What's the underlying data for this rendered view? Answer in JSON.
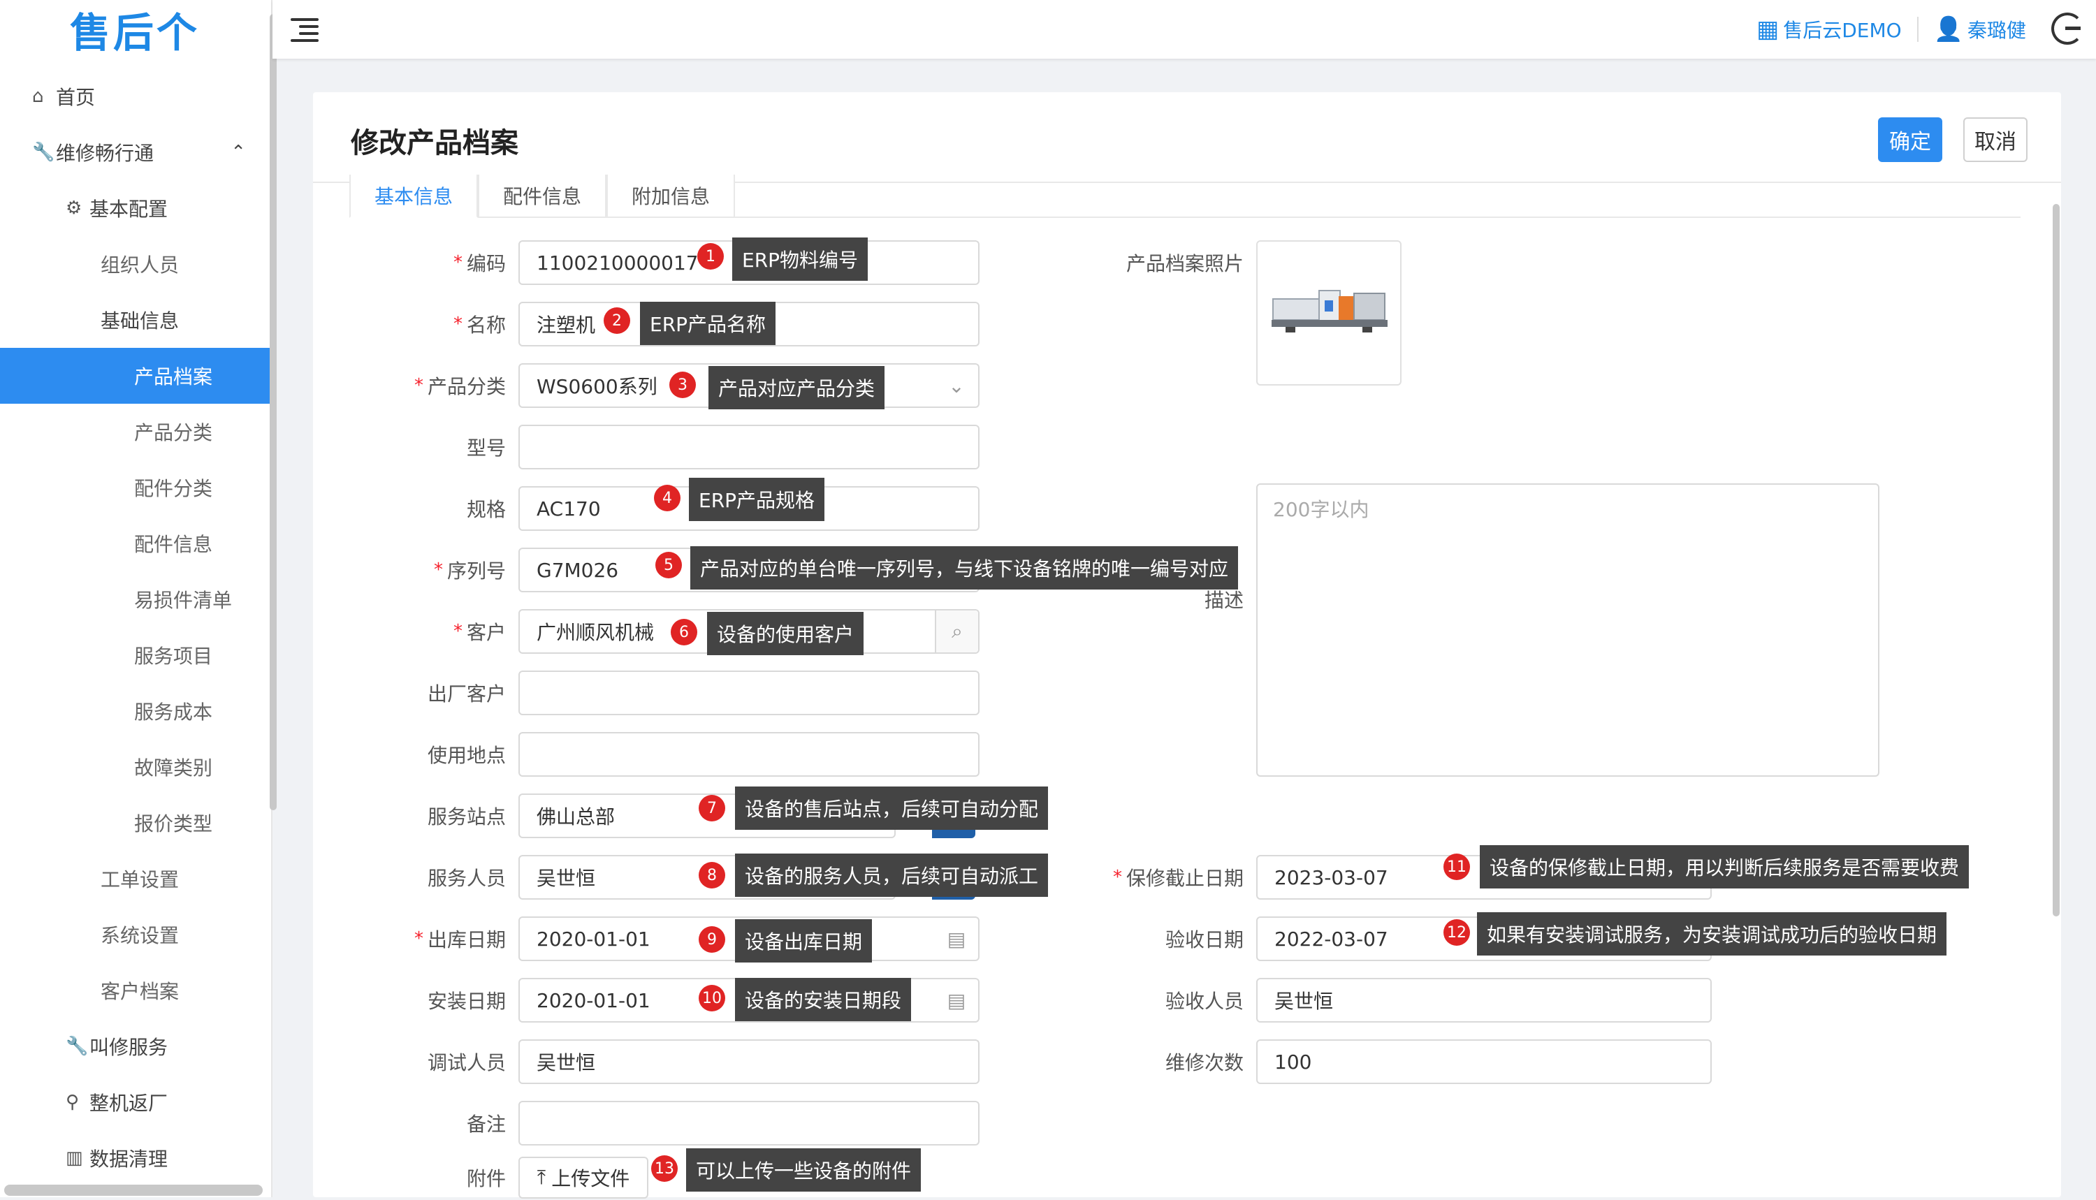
{
  "app": {
    "logo_text": "售后个",
    "org_name": "售后云DEMO",
    "user_name": "秦璐健"
  },
  "sidebar": {
    "items": [
      {
        "label": "首页",
        "icon": "home-icon"
      },
      {
        "label": "维修畅行通",
        "icon": "wrench-icon"
      },
      {
        "label": "基本配置",
        "icon": "gear-icon"
      },
      {
        "label": "组织人员"
      },
      {
        "label": "基础信息"
      },
      {
        "label": "产品档案"
      },
      {
        "label": "产品分类"
      },
      {
        "label": "配件分类"
      },
      {
        "label": "配件信息"
      },
      {
        "label": "易损件清单"
      },
      {
        "label": "服务项目"
      },
      {
        "label": "服务成本"
      },
      {
        "label": "故障类别"
      },
      {
        "label": "报价类型"
      },
      {
        "label": "工单设置"
      },
      {
        "label": "系统设置"
      },
      {
        "label": "客户档案"
      },
      {
        "label": "叫修服务",
        "icon": "wrench-icon"
      },
      {
        "label": "整机返厂",
        "icon": "link-icon"
      },
      {
        "label": "数据清理",
        "icon": "building-icon"
      }
    ]
  },
  "page": {
    "title": "修改产品档案",
    "confirm_label": "确定",
    "cancel_label": "取消",
    "tabs": [
      {
        "label": "基本信息"
      },
      {
        "label": "配件信息"
      },
      {
        "label": "附加信息"
      }
    ]
  },
  "form": {
    "code": {
      "label": "编码",
      "value": "1100210000017"
    },
    "name": {
      "label": "名称",
      "value": "注塑机"
    },
    "category": {
      "label": "产品分类",
      "value": "WS0600系列"
    },
    "model": {
      "label": "型号",
      "value": ""
    },
    "spec": {
      "label": "规格",
      "value": "AC170"
    },
    "serial": {
      "label": "序列号",
      "value": "G7M026"
    },
    "customer": {
      "label": "客户",
      "value": "广州顺风机械"
    },
    "factory_customer": {
      "label": "出厂客户",
      "value": ""
    },
    "location": {
      "label": "使用地点",
      "value": ""
    },
    "station": {
      "label": "服务站点",
      "value": "佛山总部"
    },
    "staff": {
      "label": "服务人员",
      "value": "吴世恒"
    },
    "outbound_date": {
      "label": "出库日期",
      "value": "2020-01-01"
    },
    "install_date": {
      "label": "安装日期",
      "value": "2020-01-01"
    },
    "debug_staff": {
      "label": "调试人员",
      "value": "吴世恒"
    },
    "remark": {
      "label": "备注",
      "value": ""
    },
    "attachment": {
      "label": "附件",
      "upload_label": "上传文件"
    },
    "photo": {
      "label": "产品档案照片"
    },
    "description": {
      "label": "描述",
      "placeholder": "200字以内"
    },
    "warranty_end": {
      "label": "保修截止日期",
      "value": "2023-03-07"
    },
    "accept_date": {
      "label": "验收日期",
      "value": "2022-03-07"
    },
    "accept_staff": {
      "label": "验收人员",
      "value": "吴世恒"
    },
    "repair_count": {
      "label": "维修次数",
      "value": "100"
    }
  },
  "annotations": [
    {
      "num": "1",
      "text": "ERP物料编号"
    },
    {
      "num": "2",
      "text": "ERP产品名称"
    },
    {
      "num": "3",
      "text": "产品对应产品分类"
    },
    {
      "num": "4",
      "text": "ERP产品规格"
    },
    {
      "num": "5",
      "text": "产品对应的单台唯一序列号，与线下设备铭牌的唯一编号对应"
    },
    {
      "num": "6",
      "text": "设备的使用客户"
    },
    {
      "num": "7",
      "text": "设备的售后站点，后续可自动分配"
    },
    {
      "num": "8",
      "text": "设备的服务人员，后续可自动派工"
    },
    {
      "num": "9",
      "text": "设备出库日期"
    },
    {
      "num": "10",
      "text": "设备的安装日期段"
    },
    {
      "num": "11",
      "text": "设备的保修截止日期，用以判断后续服务是否需要收费"
    },
    {
      "num": "12",
      "text": "如果有安装调试服务，为安装调试成功后的验收日期"
    },
    {
      "num": "13",
      "text": "可以上传一些设备的附件"
    }
  ],
  "colors": {
    "primary": "#2d8cf0",
    "required": "#f5222d",
    "marker": "#e02424",
    "tooltip": "#444444"
  }
}
